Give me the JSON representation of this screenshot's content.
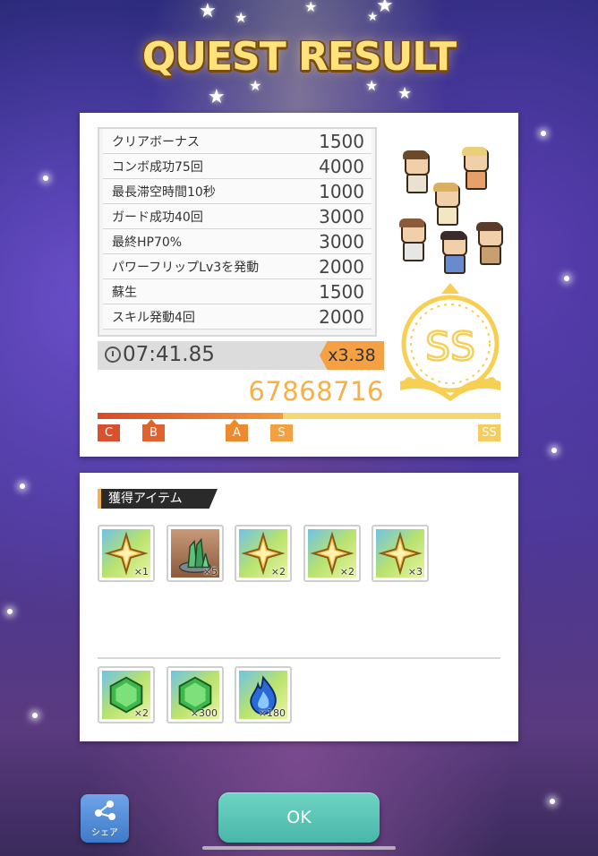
{
  "title": "QUEST RESULT",
  "bonuses": [
    {
      "name": "クリアボーナス",
      "value": "1500"
    },
    {
      "name": "コンボ成功75回",
      "value": "4000"
    },
    {
      "name": "最長滞空時間10秒",
      "value": "1000"
    },
    {
      "name": "ガード成功40回",
      "value": "3000"
    },
    {
      "name": "最終HP70%",
      "value": "3000"
    },
    {
      "name": "パワーフリップLv3を発動",
      "value": "2000"
    },
    {
      "name": "蘇生",
      "value": "1500"
    },
    {
      "name": "スキル発動4回",
      "value": "2000"
    }
  ],
  "clear_time": "07:41.85",
  "multiplier": "x3.38",
  "score": "67868716",
  "rank_grade": "SS",
  "rank_progress_percent": 46,
  "rank_marks": [
    {
      "label": "C",
      "color": "#d8502e"
    },
    {
      "label": "B",
      "color": "#e0622e"
    },
    {
      "label": "A",
      "color": "#ec8a30"
    },
    {
      "label": "S",
      "color": "#f2a040"
    },
    {
      "label": "SS",
      "color": "#f5cc60"
    }
  ],
  "items_section_label": "獲得アイテム",
  "items": [
    {
      "icon": "gold-star-crystal-icon",
      "count": "×1"
    },
    {
      "icon": "green-crystal-ore-icon",
      "count": "×5"
    },
    {
      "icon": "gold-star-crystal-icon",
      "count": "×2"
    },
    {
      "icon": "gold-star-crystal-icon",
      "count": "×2"
    },
    {
      "icon": "gold-star-crystal-icon",
      "count": "×3"
    }
  ],
  "currencies": [
    {
      "icon": "green-gem-icon",
      "count": "×2"
    },
    {
      "icon": "green-gem-icon",
      "count": "×300"
    },
    {
      "icon": "blue-flame-icon",
      "count": "×180"
    }
  ],
  "share_label": "シェア",
  "ok_label": "OK",
  "colors": {
    "accent": "#f5a042",
    "ok_button": "#5cc5b6",
    "score": "#f5b04a"
  }
}
